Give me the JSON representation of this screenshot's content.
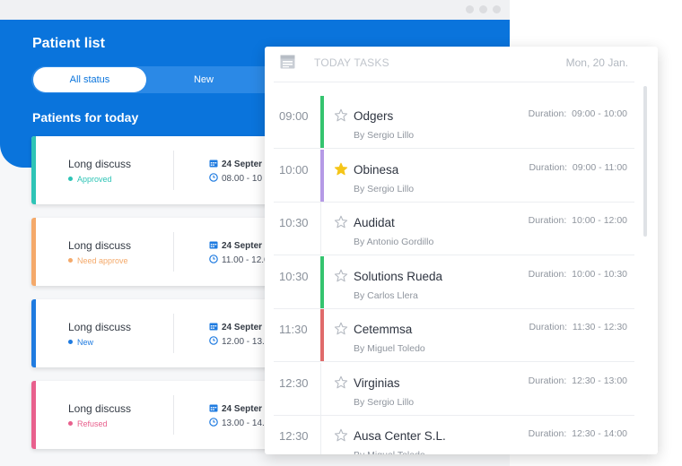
{
  "patient_list": {
    "title": "Patient list",
    "tabs": [
      {
        "label": "All status",
        "selected": true
      },
      {
        "label": "New",
        "selected": false
      }
    ],
    "section_title": "Patients for today",
    "cards": [
      {
        "title": "Long discuss",
        "status": "Approved",
        "color": "#2ec4b6",
        "date": "24 Septer",
        "time": "08.00 - 10"
      },
      {
        "title": "Long discuss",
        "status": "Need approve",
        "color": "#f4a96a",
        "date": "24 Septer",
        "time": "11.00 - 12.0"
      },
      {
        "title": "Long discuss",
        "status": "New",
        "color": "#1f7be0",
        "date": "24 Septer",
        "time": "12.00 - 13."
      },
      {
        "title": "Long discuss",
        "status": "Refused",
        "color": "#e8608d",
        "date": "24 Septer",
        "time": "13.00 - 14."
      }
    ]
  },
  "tasks": {
    "header_title": "TODAY TASKS",
    "header_date": "Mon, 20 Jan.",
    "duration_label": "Duration:",
    "items": [
      {
        "time": "09:00",
        "name": "Odgers",
        "by": "By Sergio Lillo",
        "duration": "09:00 - 10:00",
        "starred": false,
        "bar": "#35c46f"
      },
      {
        "time": "10:00",
        "name": "Obinesa",
        "by": "By Sergio Lillo",
        "duration": "09:00 - 11:00",
        "starred": true,
        "bar": "#b59ae6"
      },
      {
        "time": "10:30",
        "name": "Audidat",
        "by": "By Antonio Gordillo",
        "duration": "10:00 - 12:00",
        "starred": false,
        "bar": ""
      },
      {
        "time": "10:30",
        "name": "Solutions Rueda",
        "by": "By Carlos Llera",
        "duration": "10:00 - 10:30",
        "starred": false,
        "bar": "#35c46f"
      },
      {
        "time": "11:30",
        "name": "Cetemmsa",
        "by": "By Miguel Toledo",
        "duration": "11:30 - 12:30",
        "starred": false,
        "bar": "#e06b6b"
      },
      {
        "time": "12:30",
        "name": "Virginias",
        "by": "By Sergio Lillo",
        "duration": "12:30 - 13:00",
        "starred": false,
        "bar": ""
      },
      {
        "time": "12:30",
        "name": "Ausa Center S.L.",
        "by": "By Miguel Toledo",
        "duration": "12:30 - 14:00",
        "starred": false,
        "bar": ""
      }
    ]
  },
  "colors": {
    "brand_blue": "#0a74dc",
    "star_active": "#f5c518",
    "star_inactive": "#b5bac2"
  }
}
